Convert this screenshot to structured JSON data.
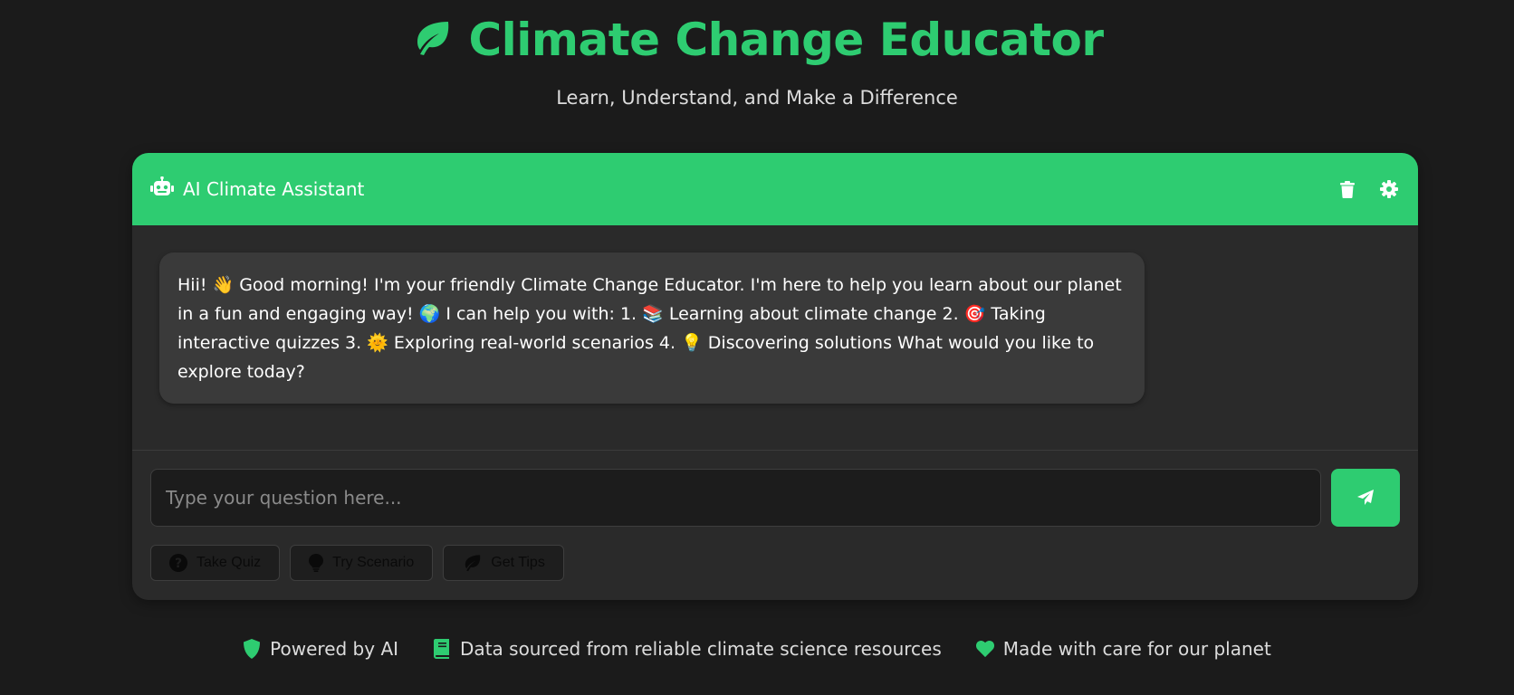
{
  "header": {
    "title": "Climate Change Educator",
    "subtitle": "Learn, Understand, and Make a Difference",
    "icon": "leaf-icon"
  },
  "chat": {
    "title": "AI Climate Assistant",
    "header_icon": "robot-icon",
    "actions": [
      {
        "icon": "trash-icon"
      },
      {
        "icon": "gear-icon"
      }
    ],
    "messages": [
      {
        "sender": "bot",
        "text": "Hii! 👋 Good morning! I'm your friendly Climate Change Educator. I'm here to help you learn about our planet in a fun and engaging way! 🌍 I can help you with: 1. 📚 Learning about climate change 2. 🎯 Taking interactive quizzes 3. 🌞 Exploring real-world scenarios 4. 💡 Discovering solutions What would you like to explore today?"
      }
    ],
    "input": {
      "placeholder": "Type your question here...",
      "value": ""
    },
    "send_icon": "paper-plane-icon",
    "quick_actions": [
      {
        "label": "Take Quiz",
        "icon": "question-circle-icon"
      },
      {
        "label": "Try Scenario",
        "icon": "lightbulb-icon"
      },
      {
        "label": "Get Tips",
        "icon": "leaf-icon"
      }
    ]
  },
  "footer": {
    "items": [
      {
        "label": "Powered by AI",
        "icon": "shield-icon"
      },
      {
        "label": "Data sourced from reliable climate science resources",
        "icon": "book-icon"
      },
      {
        "label": "Made with care for our planet",
        "icon": "heart-icon"
      }
    ]
  },
  "colors": {
    "accent": "#2ecc71",
    "background": "#1b1b1b",
    "card": "#2a2a2a",
    "message_bubble": "#3a3a3a"
  }
}
